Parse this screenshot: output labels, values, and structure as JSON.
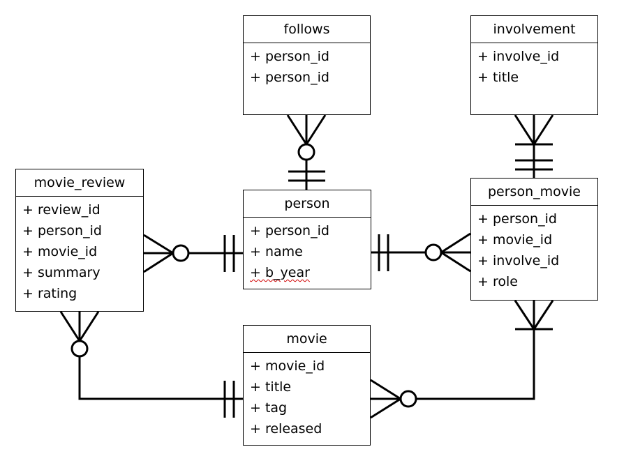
{
  "diagram": {
    "type": "entity-relationship",
    "notation": "crow's foot",
    "entities": {
      "follows": {
        "name": "follows",
        "attributes": [
          "+ person_id",
          "+ person_id"
        ]
      },
      "involvement": {
        "name": "involvement",
        "attributes": [
          "+ involve_id",
          "+ title"
        ]
      },
      "movie_review": {
        "name": "movie_review",
        "attributes": [
          "+ review_id",
          "+ person_id",
          "+ movie_id",
          "+ summary",
          "+ rating"
        ]
      },
      "person": {
        "name": "person",
        "attributes": [
          "+ person_id",
          "+ name",
          "+ b_year"
        ]
      },
      "person_movie": {
        "name": "person_movie",
        "attributes": [
          "+ person_id",
          "+ movie_id",
          "+ involve_id",
          "+ role"
        ]
      },
      "movie": {
        "name": "movie",
        "attributes": [
          "+ movie_id",
          "+ title",
          "+ tag",
          "+ released"
        ]
      }
    },
    "relationships": [
      {
        "from": "person",
        "from_cardinality": "exactly-one",
        "to": "follows",
        "to_cardinality": "zero-or-many"
      },
      {
        "from": "person",
        "from_cardinality": "exactly-one",
        "to": "movie_review",
        "to_cardinality": "zero-or-many"
      },
      {
        "from": "person",
        "from_cardinality": "exactly-one",
        "to": "person_movie",
        "to_cardinality": "zero-or-many"
      },
      {
        "from": "person_movie",
        "from_cardinality": "exactly-one",
        "to": "involvement",
        "to_cardinality": "one-or-many"
      },
      {
        "from": "movie",
        "from_cardinality": "exactly-one",
        "to": "movie_review",
        "to_cardinality": "zero-or-many"
      },
      {
        "from": "person_movie",
        "from_cardinality": "one-or-many",
        "to": "movie",
        "to_cardinality": "zero-or-many"
      }
    ],
    "spellcheck_flagged": [
      "b_year"
    ]
  }
}
